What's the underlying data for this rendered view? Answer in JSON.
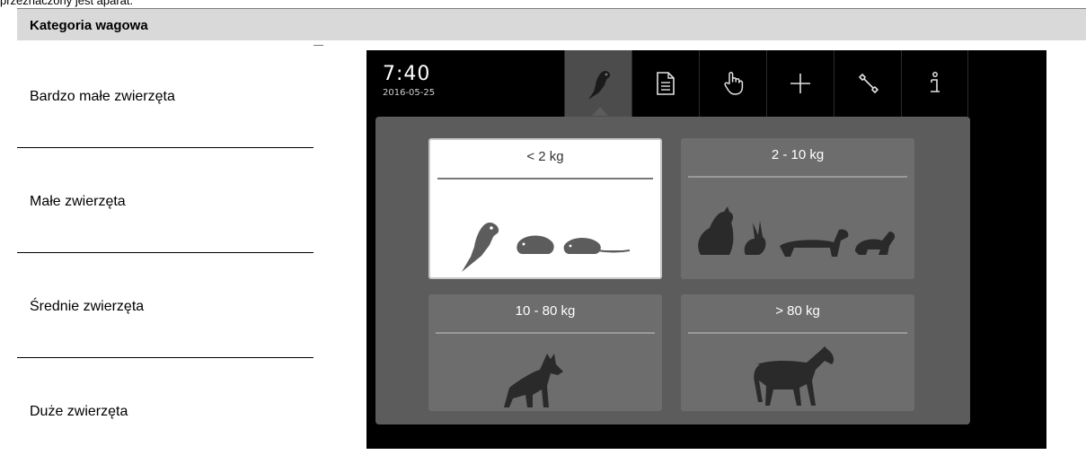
{
  "page": {
    "top_clipped_text": "przeznaczony jest aparat.",
    "header_title": "Kategoria wagowa"
  },
  "categories": [
    "Bardzo małe zwierzęta",
    "Małe zwierzęta",
    "Średnie zwierzęta",
    "Duże zwierzęta"
  ],
  "device": {
    "time": "7:40",
    "date": "2016-05-25",
    "tabs": [
      {
        "icon": "parrot-icon",
        "active": true
      },
      {
        "icon": "document-icon",
        "active": false
      },
      {
        "icon": "hand-pointer-icon",
        "active": false
      },
      {
        "icon": "plus-icon",
        "active": false
      },
      {
        "icon": "wrench-icon",
        "active": false
      },
      {
        "icon": "info-icon",
        "active": false
      }
    ],
    "cards": [
      {
        "label": "< 2 kg",
        "selected": true,
        "animals": [
          "parrot",
          "guinea-pig",
          "rat"
        ]
      },
      {
        "label": "2 - 10 kg",
        "selected": false,
        "animals": [
          "cat",
          "rabbit",
          "dachshund",
          "ferret"
        ]
      },
      {
        "label": "10 - 80 kg",
        "selected": false,
        "animals": [
          "dog"
        ]
      },
      {
        "label": "> 80 kg",
        "selected": false,
        "animals": [
          "horse"
        ]
      }
    ]
  },
  "colors": {
    "header_bg": "#d9d9d9",
    "screen_bg": "#000000",
    "panel_bg": "#5c5c5c",
    "card_bg": "#6d6d6d",
    "card_selected_bg": "#ffffff",
    "silhouette": "#5c5c5c",
    "silhouette_dark": "#2a2a2a"
  }
}
